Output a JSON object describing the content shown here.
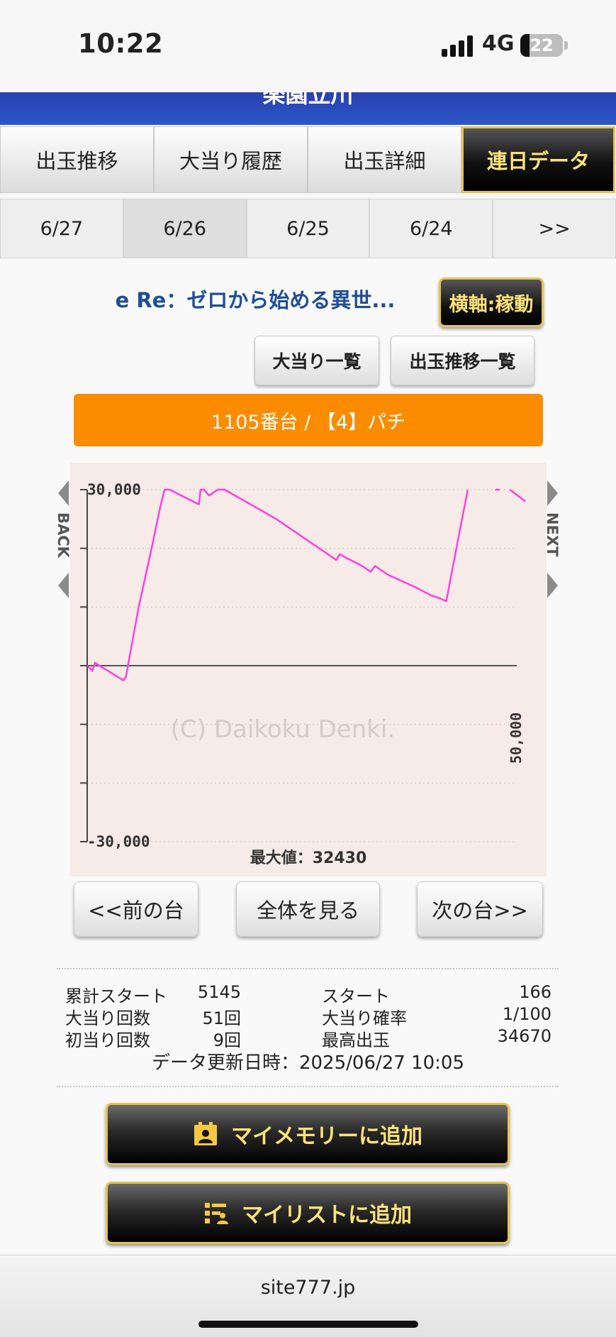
{
  "status_bar": {
    "time": "10:22",
    "network": "4G",
    "battery_level": "22",
    "battery_fraction": 0.22
  },
  "banner": {
    "title": "楽園立川"
  },
  "main_tabs": [
    {
      "label": "出玉推移"
    },
    {
      "label": "大当り履歴"
    },
    {
      "label": "出玉詳細"
    },
    {
      "label": "連日データ",
      "active": true
    }
  ],
  "date_tabs": [
    {
      "label": "6/27"
    },
    {
      "label": "6/26",
      "active": true
    },
    {
      "label": "6/25"
    },
    {
      "label": "6/24"
    },
    {
      "label": ">>"
    }
  ],
  "machine": {
    "title": "e Re：ゼロから始める異世...",
    "axis_button": "横軸:稼動",
    "bonus_list_button": "大当り一覧",
    "payout_list_button": "出玉推移一覧",
    "unit_label": "1105番台 / 【4】パチ"
  },
  "chart_data": {
    "type": "line",
    "y_ticks": [
      "30,000",
      "-30,000"
    ],
    "x_tick_label": "50,000",
    "ylim": [
      -30000,
      30000
    ],
    "xlim": [
      0,
      50000
    ],
    "watermark": "(C) Daikoku Denki.",
    "max_label": "最大値：32430",
    "side_labels": {
      "left": "BACK",
      "right": "NEXT"
    },
    "line_color": "#ff3fe0",
    "series": [
      {
        "points": [
          [
            0,
            0
          ],
          [
            600,
            -900
          ],
          [
            900,
            500
          ],
          [
            4200,
            -2500
          ],
          [
            4500,
            -2000
          ],
          [
            6000,
            10000
          ],
          [
            7500,
            20000
          ],
          [
            8500,
            27000
          ],
          [
            9000,
            30000
          ],
          [
            9600,
            30000
          ],
          [
            13000,
            27500
          ],
          [
            13200,
            30000
          ],
          [
            13600,
            30000
          ],
          [
            14200,
            29000
          ],
          [
            15200,
            30000
          ],
          [
            16000,
            30000
          ],
          [
            22000,
            25000
          ],
          [
            25000,
            22000
          ],
          [
            28000,
            19000
          ],
          [
            29000,
            18000
          ],
          [
            29400,
            19000
          ],
          [
            30000,
            18500
          ],
          [
            32000,
            17000
          ],
          [
            33000,
            16000
          ],
          [
            33500,
            17000
          ],
          [
            35000,
            15500
          ],
          [
            38000,
            13500
          ],
          [
            40000,
            12000
          ],
          [
            41000,
            11500
          ],
          [
            41800,
            11000
          ],
          [
            43500,
            24000
          ],
          [
            44300,
            30000
          ]
        ]
      },
      {
        "points": [
          [
            47500,
            30200
          ],
          [
            48000,
            30000
          ]
        ]
      },
      {
        "points": [
          [
            49200,
            30000
          ],
          [
            51000,
            28000
          ]
        ]
      }
    ]
  },
  "nav_buttons": {
    "prev": "<<前の台",
    "all": "全体を見る",
    "next": "次の台>>"
  },
  "stats": {
    "total_start_label": "累計スタート",
    "total_start_value": "5145",
    "start_label": "スタート",
    "start_value": "166",
    "bonus_count_label": "大当り回数",
    "bonus_count_value": "51回",
    "bonus_prob_label": "大当り確率",
    "bonus_prob_value": "1/100",
    "first_hit_label": "初当り回数",
    "first_hit_value": "9回",
    "max_payout_label": "最高出玉",
    "max_payout_value": "34670",
    "updated": "データ更新日時：2025/06/27 10:05"
  },
  "actions": {
    "add_memory": "マイメモリーに追加",
    "add_list": "マイリストに追加"
  },
  "footer": {
    "url": "site777.jp"
  }
}
